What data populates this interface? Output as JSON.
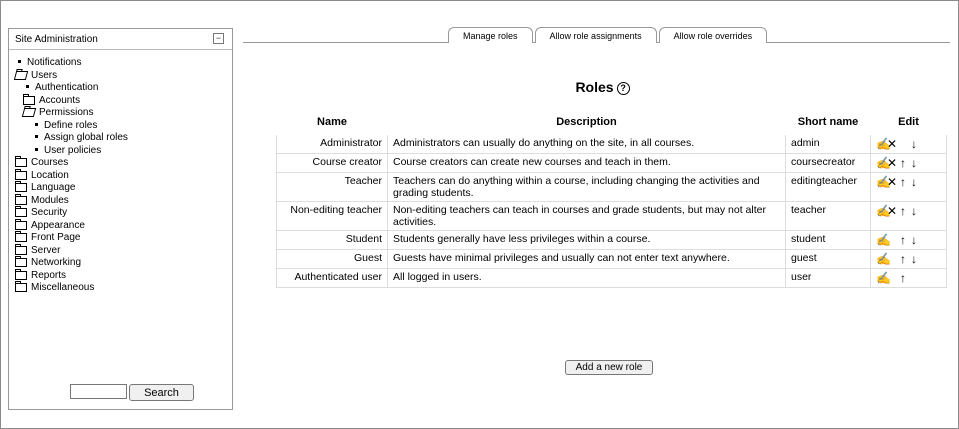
{
  "sidebar": {
    "title": "Site Administration",
    "collapse_symbol": "−",
    "items": [
      {
        "label": "Notifications",
        "icon": "bullet-icon",
        "level": 0
      },
      {
        "label": "Users",
        "icon": "folder-open-icon",
        "level": 0
      },
      {
        "label": "Authentication",
        "icon": "bullet-icon",
        "level": 1
      },
      {
        "label": "Accounts",
        "icon": "folder-icon",
        "level": 1
      },
      {
        "label": "Permissions",
        "icon": "folder-open-icon",
        "level": 1
      },
      {
        "label": "Define roles",
        "icon": "bullet-icon",
        "level": 2
      },
      {
        "label": "Assign global roles",
        "icon": "bullet-icon",
        "level": 2
      },
      {
        "label": "User policies",
        "icon": "bullet-icon",
        "level": 2
      },
      {
        "label": "Courses",
        "icon": "folder-icon",
        "level": 0
      },
      {
        "label": "Location",
        "icon": "folder-icon",
        "level": 0
      },
      {
        "label": "Language",
        "icon": "folder-icon",
        "level": 0
      },
      {
        "label": "Modules",
        "icon": "folder-icon",
        "level": 0
      },
      {
        "label": "Security",
        "icon": "folder-icon",
        "level": 0
      },
      {
        "label": "Appearance",
        "icon": "folder-icon",
        "level": 0
      },
      {
        "label": "Front Page",
        "icon": "folder-icon",
        "level": 0
      },
      {
        "label": "Server",
        "icon": "folder-icon",
        "level": 0
      },
      {
        "label": "Networking",
        "icon": "folder-icon",
        "level": 0
      },
      {
        "label": "Reports",
        "icon": "folder-icon",
        "level": 0
      },
      {
        "label": "Miscellaneous",
        "icon": "folder-icon",
        "level": 0
      }
    ],
    "search": {
      "value": "",
      "button": "Search"
    }
  },
  "tabs": [
    "Manage roles",
    "Allow role assignments",
    "Allow role overrides"
  ],
  "page": {
    "title": "Roles",
    "help_symbol": "?"
  },
  "table": {
    "headers": [
      "Name",
      "Description",
      "Short name",
      "Edit"
    ],
    "rows": [
      {
        "name": "Administrator",
        "description": "Administrators can usually do anything on the site, in all courses.",
        "short": "admin",
        "edit": [
          "edit-icon",
          "delete-icon",
          "",
          "move-down-icon"
        ]
      },
      {
        "name": "Course creator",
        "description": "Course creators can create new courses and teach in them.",
        "short": "coursecreator",
        "edit": [
          "edit-icon",
          "delete-icon",
          "move-up-icon",
          "move-down-icon"
        ]
      },
      {
        "name": "Teacher",
        "description": "Teachers can do anything within a course, including changing the activities and grading students.",
        "short": "editingteacher",
        "edit": [
          "edit-icon",
          "delete-icon",
          "move-up-icon",
          "move-down-icon"
        ]
      },
      {
        "name": "Non-editing teacher",
        "description": "Non-editing teachers can teach in courses and grade students, but may not alter activities.",
        "short": "teacher",
        "edit": [
          "edit-icon",
          "delete-icon",
          "move-up-icon",
          "move-down-icon"
        ]
      },
      {
        "name": "Student",
        "description": "Students generally have less privileges within a course.",
        "short": "student",
        "edit": [
          "edit-icon",
          "",
          "move-up-icon",
          "move-down-icon"
        ]
      },
      {
        "name": "Guest",
        "description": "Guests have minimal privileges and usually can not enter text anywhere.",
        "short": "guest",
        "edit": [
          "edit-icon",
          "",
          "move-up-icon",
          "move-down-icon"
        ]
      },
      {
        "name": "Authenticated user",
        "description": "All logged in users.",
        "short": "user",
        "edit": [
          "edit-icon",
          "",
          "move-up-icon",
          ""
        ]
      }
    ]
  },
  "add_button": "Add a new role"
}
